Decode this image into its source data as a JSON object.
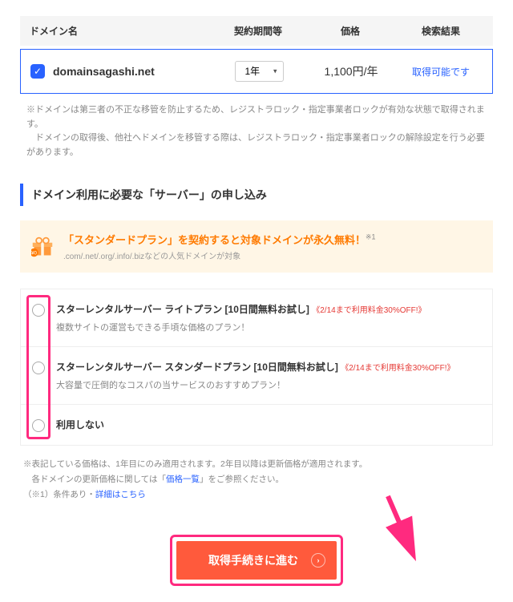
{
  "table": {
    "headers": {
      "domain": "ドメイン名",
      "period": "契約期間等",
      "price": "価格",
      "result": "検索結果"
    },
    "row": {
      "domain": "domainsagashi.net",
      "period_value": "1年",
      "price": "1,100円/年",
      "result": "取得可能です"
    }
  },
  "table_note1": "※ドメインは第三者の不正な移管を防止するため、レジストラロック・指定事業者ロックが有効な状態で取得されます。",
  "table_note2": "　ドメインの取得後、他社へドメインを移管する際は、レジストラロック・指定事業者ロックの解除設定を行う必要があります。",
  "section": "ドメイン利用に必要な「サーバー」の申し込み",
  "promo": {
    "line1": "「スタンダードプラン」を契約すると対象ドメインが永久無料！",
    "note_mark": "※1",
    "line2": ".com/.net/.org/.info/.bizなどの人気ドメインが対象"
  },
  "plans": [
    {
      "title": "スターレンタルサーバー ライトプラン [10日間無料お試し]",
      "badge": "《2/14まで利用料金30%OFF!》",
      "desc": "複数サイトの運営もできる手頃な価格のプラン！"
    },
    {
      "title": "スターレンタルサーバー スタンダードプラン [10日間無料お試し]",
      "badge": "《2/14まで利用料金30%OFF!》",
      "desc": "大容量で圧倒的なコスパの当サービスのおすすめプラン！"
    },
    {
      "title": "利用しない",
      "badge": "",
      "desc": ""
    }
  ],
  "footnotes": {
    "l1": "※表記している価格は、1年目にのみ適用されます。2年目以降は更新価格が適用されます。",
    "l2_pre": "　各ドメインの更新価格に関しては「",
    "l2_link": "価格一覧",
    "l2_post": "」をご参照ください。",
    "l3_pre": "（※1）条件あり・",
    "l3_link": "詳細はこちら"
  },
  "cta": "取得手続きに進む"
}
